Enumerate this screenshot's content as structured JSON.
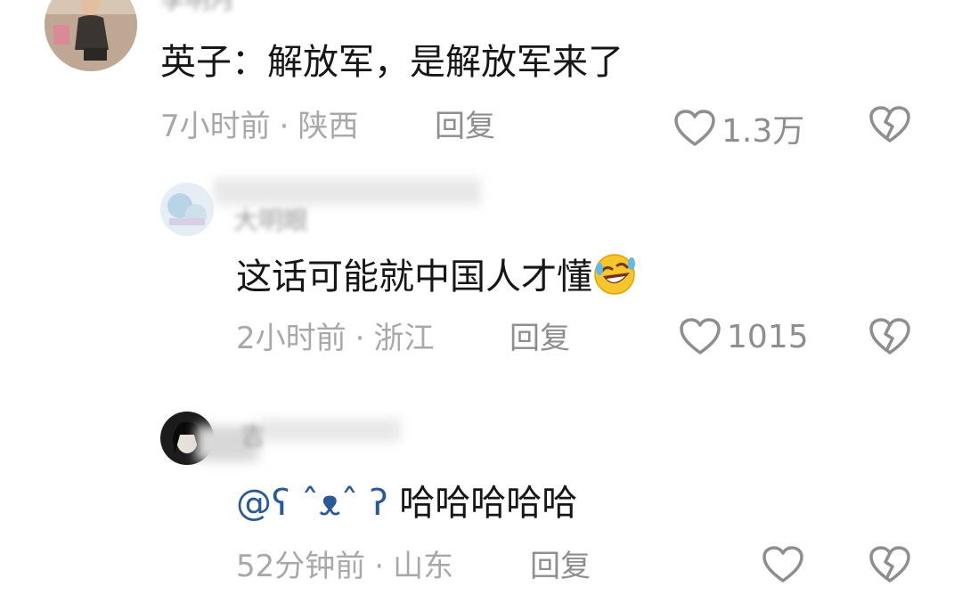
{
  "comments": [
    {
      "username": "李明月",
      "text": "英子：解放军，是解放军来了",
      "time": "7小时前",
      "location": "陕西",
      "reply_label": "回复",
      "likes": "1.3万"
    },
    {
      "username": "大明眼",
      "text": "这话可能就中国人才懂",
      "emoji": "rolling-on-floor-laughing",
      "time": "2小时前",
      "location": "浙江",
      "reply_label": "回复",
      "likes": "1015"
    },
    {
      "username": "吉",
      "mention": "@ʕ ˆᴥˆ ʔ",
      "text": " 哈哈哈哈哈",
      "time": "52分钟前",
      "location": "山东",
      "reply_label": "回复",
      "likes": ""
    }
  ],
  "colors": {
    "meta_gray": "#a8a8a8",
    "icon_gray": "#8e8e8e",
    "mention_blue": "#2a5a96",
    "text": "#161616"
  },
  "icons": {
    "like": "heart-outline-icon",
    "dislike": "broken-heart-icon"
  }
}
